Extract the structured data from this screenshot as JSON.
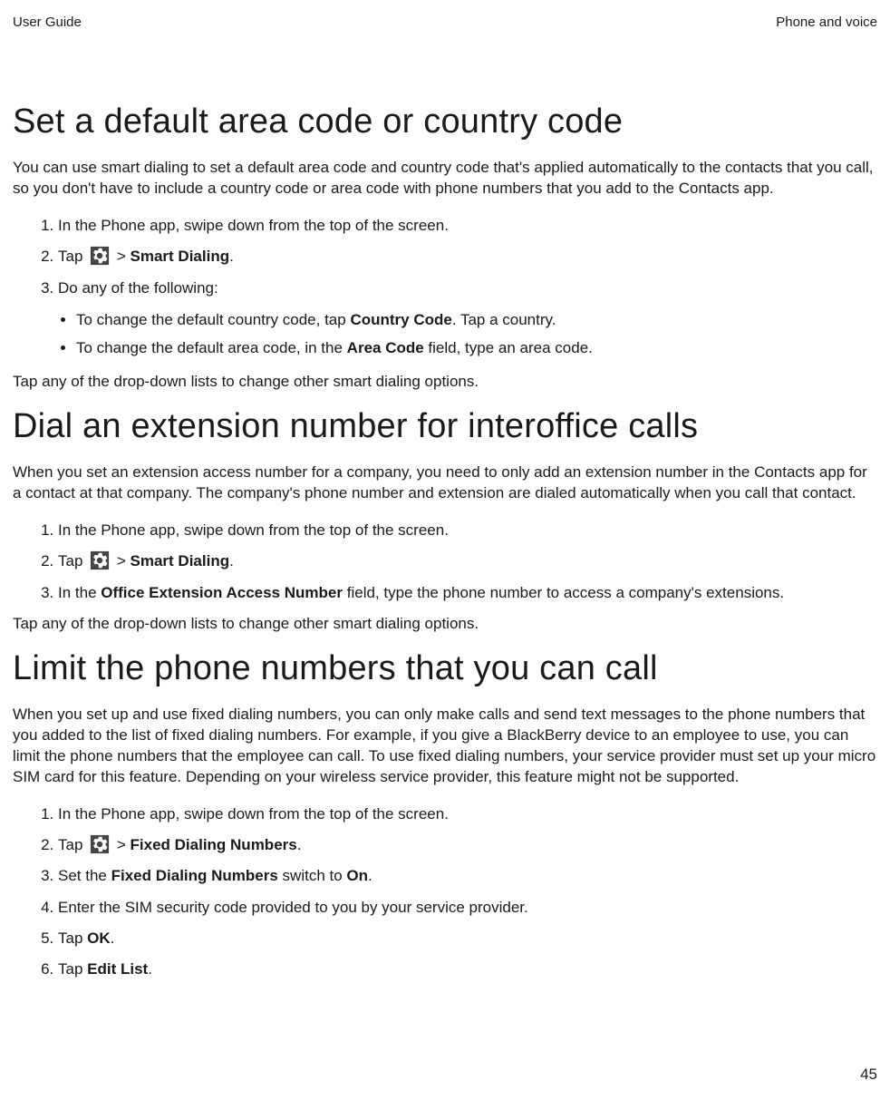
{
  "header": {
    "left": "User Guide",
    "right": "Phone and voice"
  },
  "section1": {
    "title": "Set a default area code or country code",
    "intro": "You can use smart dialing to set a default area code and country code that's applied automatically to the contacts that you call, so you don't have to include a country code or area code with phone numbers that you add to the Contacts app.",
    "step1": "In the Phone app, swipe down from the top of the screen.",
    "step2a": "Tap ",
    "step2b": " > ",
    "step2c": "Smart Dialing",
    "step2d": ".",
    "step3": "Do any of the following:",
    "bullet1a": "To change the default country code, tap ",
    "bullet1b": "Country Code",
    "bullet1c": ". Tap a country.",
    "bullet2a": "To change the default area code, in the ",
    "bullet2b": "Area Code",
    "bullet2c": " field, type an area code.",
    "outro": "Tap any of the drop-down lists to change other smart dialing options."
  },
  "section2": {
    "title": "Dial an extension number for interoffice calls",
    "intro": "When you set an extension access number for a company, you need to only add an extension number in the Contacts app for a contact at that company. The company's phone number and extension are dialed automatically when you call that contact.",
    "step1": "In the Phone app, swipe down from the top of the screen.",
    "step2a": "Tap ",
    "step2b": " > ",
    "step2c": "Smart Dialing",
    "step2d": ".",
    "step3a": "In the ",
    "step3b": "Office Extension Access Number",
    "step3c": " field, type the phone number to access a company's extensions.",
    "outro": "Tap any of the drop-down lists to change other smart dialing options."
  },
  "section3": {
    "title": "Limit the phone numbers that you can call",
    "intro": "When you set up and use fixed dialing numbers, you can only make calls and send text messages to the phone numbers that you added to the list of fixed dialing numbers. For example, if you give a BlackBerry device to an employee to use, you can limit the phone numbers that the employee can call. To use fixed dialing numbers, your service provider must set up your micro SIM card for this feature. Depending on your wireless service provider, this feature might not be supported.",
    "step1": "In the Phone app, swipe down from the top of the screen.",
    "step2a": "Tap ",
    "step2b": " > ",
    "step2c": "Fixed Dialing Numbers",
    "step2d": ".",
    "step3a": "Set the ",
    "step3b": "Fixed Dialing Numbers",
    "step3c": " switch to ",
    "step3d": "On",
    "step3e": ".",
    "step4": "Enter the SIM security code provided to you by your service provider.",
    "step5a": "Tap ",
    "step5b": "OK",
    "step5c": ".",
    "step6a": "Tap ",
    "step6b": "Edit List",
    "step6c": "."
  },
  "pageNumber": "45"
}
